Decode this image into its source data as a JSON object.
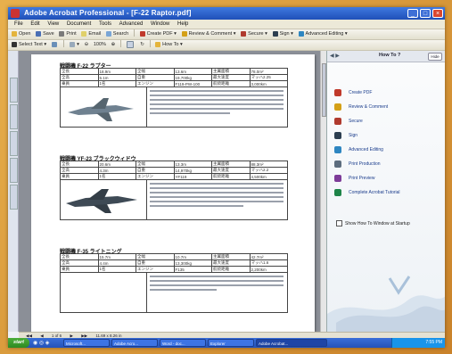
{
  "window": {
    "title": "Adobe Acrobat Professional - [F-22 Raptor.pdf]"
  },
  "menu": [
    "File",
    "Edit",
    "View",
    "Document",
    "Tools",
    "Advanced",
    "Window",
    "Help"
  ],
  "toolbar1": {
    "items": [
      "Open",
      "Save",
      "Print",
      "Email",
      "Search",
      "Create PDF",
      "Review & Comment",
      "Secure",
      "Sign",
      "Advanced Editing"
    ]
  },
  "toolbar2": {
    "items": [
      "Select Text",
      "Snapshot",
      "Zoom",
      "100%",
      "Fit Width",
      "How To"
    ]
  },
  "document": {
    "entries": [
      {
        "title": "戦闘機 F-22 ラプター",
        "rows": [
          [
            "全長",
            "18.9m",
            "全幅",
            "13.6m",
            "主翼面積",
            "78.0m²"
          ],
          [
            "全高",
            "5.1m",
            "自重",
            "19,700kg",
            "最大速度",
            "マッハ2.25"
          ],
          [
            "乗員",
            "1名",
            "エンジン",
            "F119-PW-100",
            "航続距離",
            "3,000km"
          ]
        ]
      },
      {
        "title": "戦闘機 YF-23 ブラックウィドウ",
        "rows": [
          [
            "全長",
            "20.6m",
            "全幅",
            "13.3m",
            "主翼面積",
            "88.3m²"
          ],
          [
            "全高",
            "4.3m",
            "自重",
            "14,970kg",
            "最大速度",
            "マッハ2.2"
          ],
          [
            "乗員",
            "1名",
            "エンジン",
            "YF119",
            "航続距離",
            "4,500km"
          ]
        ]
      },
      {
        "title": "戦闘機 F-35 ライトニング",
        "rows": [
          [
            "全長",
            "15.7m",
            "全幅",
            "10.7m",
            "主翼面積",
            "42.7m²"
          ],
          [
            "全高",
            "4.4m",
            "自重",
            "13,300kg",
            "最大速度",
            "マッハ1.6"
          ],
          [
            "乗員",
            "1名",
            "エンジン",
            "F135",
            "航続距離",
            "2,200km"
          ]
        ]
      }
    ]
  },
  "howto": {
    "title": "How To ?",
    "hide_label": "Hide",
    "items": [
      {
        "label": "Create PDF",
        "icon": "create-pdf-icon",
        "color": "#c0392b"
      },
      {
        "label": "Review & Comment",
        "icon": "review-comment-icon",
        "color": "#d4a017"
      },
      {
        "label": "Secure",
        "icon": "lock-icon",
        "color": "#b03a2e"
      },
      {
        "label": "Sign",
        "icon": "pen-icon",
        "color": "#2c3e50"
      },
      {
        "label": "Advanced Editing",
        "icon": "edit-icon",
        "color": "#2e86c1"
      },
      {
        "label": "Print Production",
        "icon": "printer-icon",
        "color": "#5d6d7e"
      },
      {
        "label": "Print Preview",
        "icon": "preview-icon",
        "color": "#7d3c98"
      },
      {
        "label": "Complete Acrobat Tutorial",
        "icon": "help-icon",
        "color": "#1e8449"
      }
    ],
    "checkbox_label": "Show How To Window at Startup"
  },
  "navbar": {
    "items": [
      "◀◀",
      "◀",
      "1 of 6",
      "▶",
      "▶▶",
      "11.69 x 8.26 in"
    ]
  },
  "taskbar": {
    "start": "start",
    "tasks": [
      "Microsoft...",
      "Adobe Acro...",
      "Word - doc...",
      "Explorer",
      "Adobe Acrobat..."
    ],
    "clock": "7:55 PM"
  }
}
